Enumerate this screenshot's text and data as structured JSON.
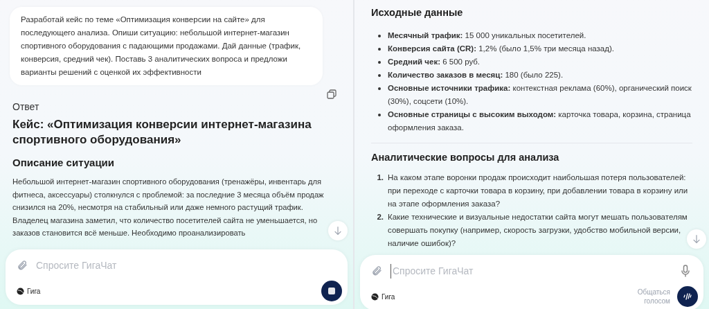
{
  "left_panel": {
    "user_message": "Разработай кейс по теме «Оптимизация конверсии на сайте» для последующего анализа. Опиши ситуацию: небольшой интернет-магазин спортивного оборудования с падающими продажами. Дай данные (трафик, конверсия, средний чек). Поставь 3 аналитических вопроса и предложи варианты решений с оценкой их эффективности",
    "answer_label": "Ответ",
    "title": "Кейс: «Оптимизация конверсии интернет-магазина спортивного оборудования»",
    "section_heading": "Описание ситуации",
    "paragraph": "Небольшой интернет-магазин спортивного оборудования (тренажёры, инвентарь для фитнеса, аксессуары) столкнулся с проблемой: за последние 3 месяца объём продаж снизился на 20%, несмотря на стабильный или даже немного растущий трафик. Владелец магазина заметил, что количество посетителей сайта не уменьшается, но заказов становится всё меньше. Необходимо проанализировать",
    "composer": {
      "placeholder": "Спросите ГигаЧат",
      "model_label": "Гига",
      "generating": true
    }
  },
  "right_panel": {
    "data_heading": "Исходные данные",
    "data_items": [
      "**Месячный трафик:** 15 000 уникальных посетителей.",
      "**Конверсия сайта (CR):** 1,2% (было 1,5% три месяца назад).",
      "**Средний чек:** 6 500 руб.",
      "**Количество заказов в месяц:** 180 (было 225).",
      "**Основные источники трафика:** контекстная реклама (60%), органический поиск (30%), соцсети (10%).",
      "**Основные страницы с высоким выходом:** карточка товара, корзина, страница оформления заказа."
    ],
    "questions_heading": "Аналитические вопросы для анализа",
    "questions": [
      {
        "number": "1.",
        "text": "На каком этапе воронки продаж происходит наибольшая потеря пользователей: при переходе с карточки товара в корзину, при добавлении товара в корзину или на этапе оформления заказа?"
      },
      {
        "number": "2.",
        "text": "Какие технические и визуальные недостатки сайта могут мешать пользователям совершать покупку (например, скорость загрузки, удобство мобильной версии, наличие ошибок)?"
      }
    ],
    "composer": {
      "placeholder": "Спросите ГигаЧат",
      "focused": true,
      "model_label": "Гига",
      "voice_label": "Общаться голосом"
    }
  }
}
